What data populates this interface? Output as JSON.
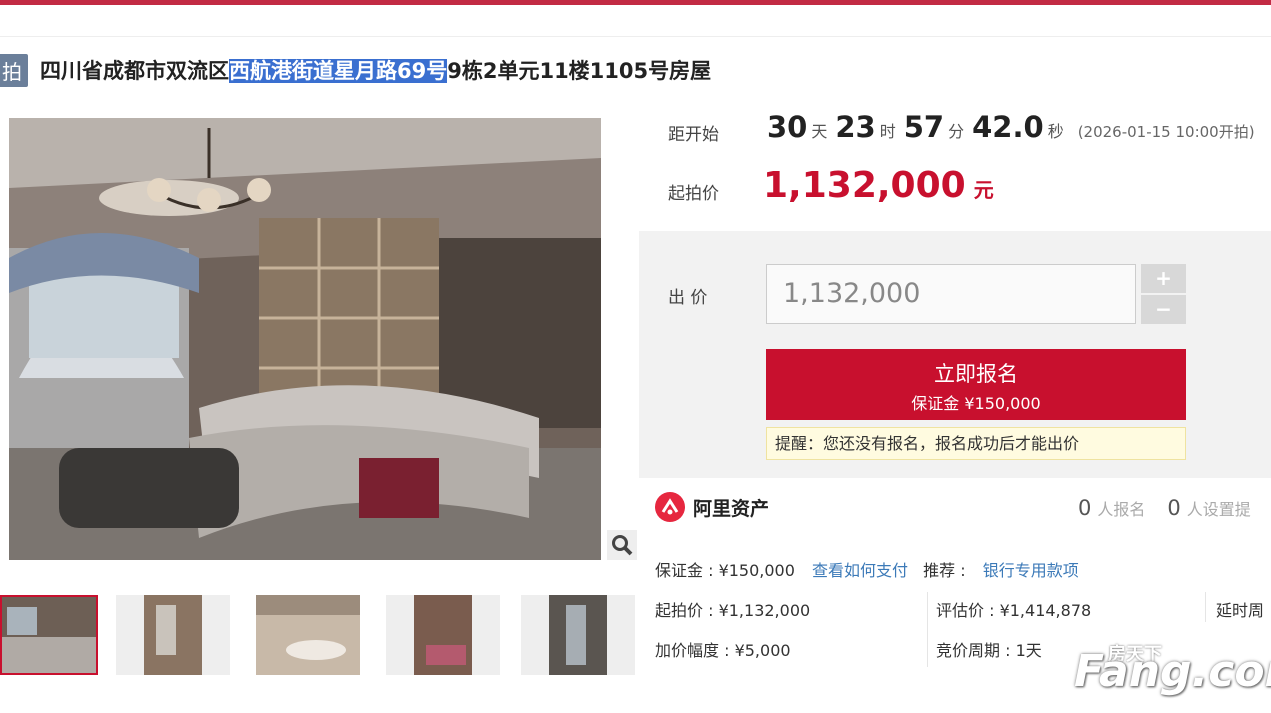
{
  "header": {
    "tag": "拍",
    "title_plain_before": "四川省成都市双流区",
    "title_highlight": "西航港街道星月路69号",
    "title_plain_after": "9栋2单元11楼1105号房屋"
  },
  "countdown": {
    "label": "距开始",
    "days": "30",
    "days_unit": "天",
    "hours": "23",
    "hours_unit": "时",
    "minutes": "57",
    "minutes_unit": "分",
    "seconds": "42.0",
    "seconds_unit": "秒",
    "start_note": "(2026-01-15 10:00开拍)"
  },
  "start_price": {
    "label": "起拍价",
    "value": "1,132,000",
    "unit": "元"
  },
  "bid": {
    "label": "出 价",
    "input_value": "1,132,000",
    "plus": "+",
    "minus": "−",
    "signup_label": "立即报名",
    "deposit_line": "保证金 ¥150,000",
    "notice": "提醒：您还没有报名，报名成功后才能出价"
  },
  "platform": {
    "name": "阿里资产",
    "signup_count": "0",
    "signup_unit": "人报名",
    "reminder_count": "0",
    "reminder_unit": "人设置提"
  },
  "details": {
    "deposit": "保证金 : ¥150,000",
    "how_to_pay": "查看如何支付",
    "recommend_label": "推荐 :",
    "recommend_link": "银行专用款项",
    "start_price": "起拍价 : ¥1,132,000",
    "appraisal": "评估价 : ¥1,414,878",
    "delay": "延时周",
    "increment": "加价幅度 : ¥5,000",
    "cycle": "竞价周期 : 1天"
  },
  "watermark": {
    "brand": "Fang.com",
    "cn": "房天下"
  },
  "colors": {
    "accent": "#c8102e",
    "link": "#3c7ab8",
    "tag": "#6b7f9a"
  }
}
